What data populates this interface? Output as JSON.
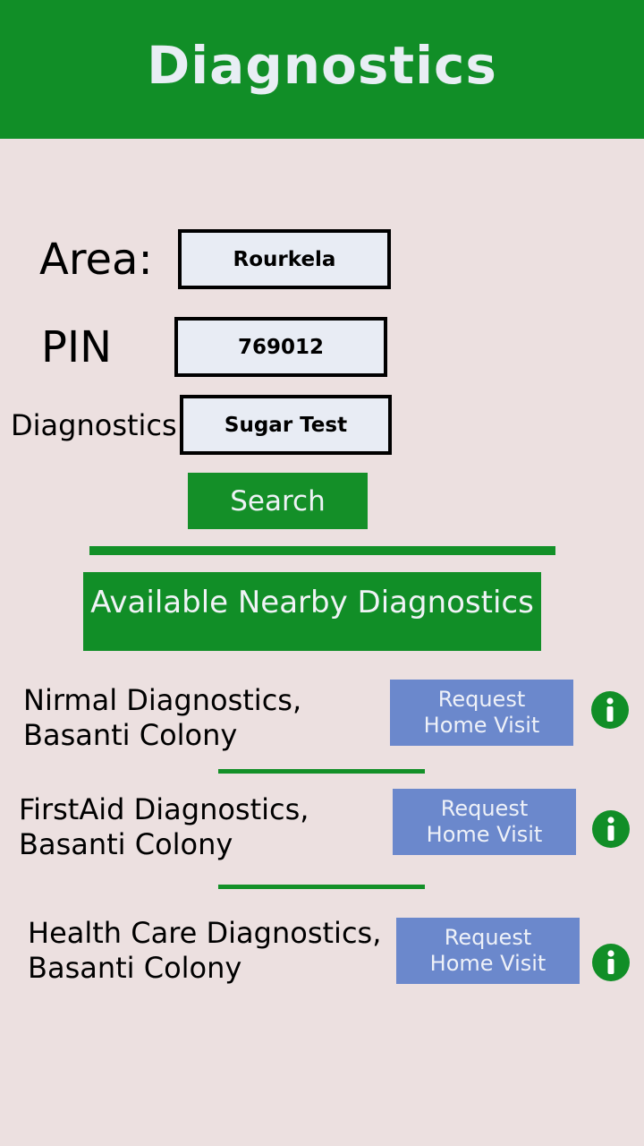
{
  "header": {
    "title": "Diagnostics"
  },
  "form": {
    "area_label": "Area:",
    "area_value": "Rourkela",
    "pin_label": "PIN",
    "pin_value": "769012",
    "diagnostics_label": "Diagnostics",
    "diagnostics_value": "Sugar Test",
    "search_label": "Search"
  },
  "results": {
    "heading": "Available Nearby Diagnostics",
    "items": [
      {
        "name_line1": "Nirmal Diagnostics,",
        "name_line2": "Basanti Colony",
        "button_line1": "Request",
        "button_line2": "Home Visit"
      },
      {
        "name_line1": "FirstAid Diagnostics,",
        "name_line2": "Basanti Colony",
        "button_line1": "Request",
        "button_line2": "Home Visit"
      },
      {
        "name_line1": "Health Care Diagnostics,",
        "name_line2": "Basanti Colony",
        "button_line1": "Request",
        "button_line2": "Home Visit"
      }
    ]
  },
  "icons": {
    "info": "info-icon"
  },
  "colors": {
    "primary_green": "#118e27",
    "button_blue": "#6b88cc",
    "background": "#ece0e0"
  }
}
